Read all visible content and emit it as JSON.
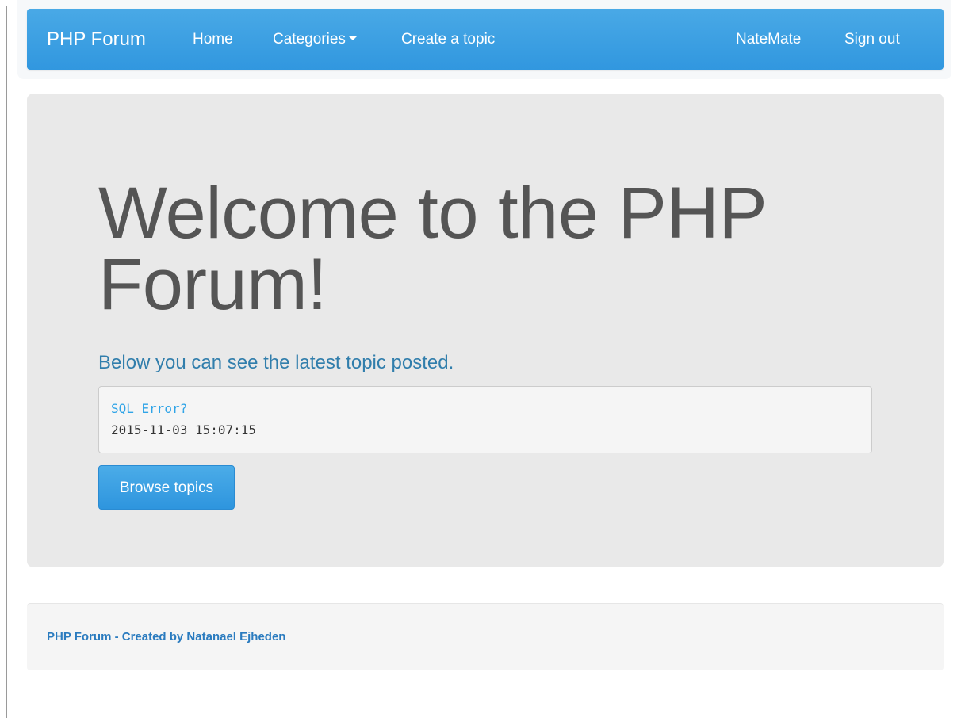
{
  "navbar": {
    "brand": "PHP Forum",
    "items": [
      {
        "label": "Home"
      },
      {
        "label": "Categories"
      },
      {
        "label": "Create a topic"
      }
    ],
    "right_items": [
      {
        "label": "NateMate"
      },
      {
        "label": "Sign out"
      }
    ],
    "colors": {
      "background": "#3aa0e4",
      "text": "#ffffff"
    }
  },
  "jumbotron": {
    "title": "Welcome to the PHP Forum!",
    "lead": "Below you can see the latest topic posted.",
    "latest_topic": {
      "title": "SQL Error?",
      "date": "2015-11-03 15:07:15"
    },
    "button_label": "Browse topics",
    "colors": {
      "background": "#e9e9e9",
      "title": "#555555",
      "lead": "#317eac",
      "link": "#2fa4e7"
    }
  },
  "footer": {
    "text": "PHP Forum - Created by Natanael Ejheden",
    "colors": {
      "background": "#f5f5f5",
      "text": "#2a7bbf"
    }
  },
  "icons": {
    "categories_dropdown": "caret-down-icon"
  }
}
